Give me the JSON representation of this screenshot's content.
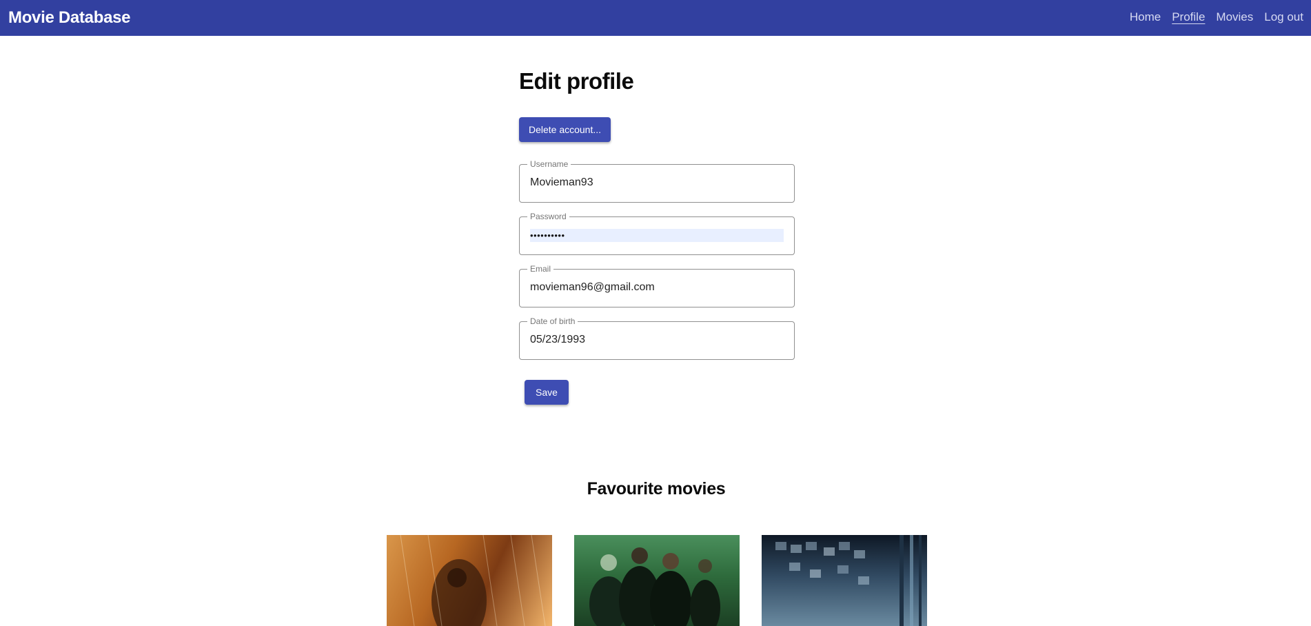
{
  "navbar": {
    "brand": "Movie Database",
    "links": [
      "Home",
      "Profile",
      "Movies",
      "Log out"
    ],
    "active": "Profile",
    "background": "#3240a0"
  },
  "page": {
    "title": "Edit profile",
    "delete_button": "Delete account...",
    "save_button": "Save"
  },
  "form": {
    "username": {
      "label": "Username",
      "value": "Movieman93"
    },
    "password": {
      "label": "Password",
      "value": "••••••••••"
    },
    "email": {
      "label": "Email",
      "value": "movieman96@gmail.com"
    },
    "dob": {
      "label": "Date of birth",
      "value": "05/23/1993"
    }
  },
  "favourites": {
    "title": "Favourite movies",
    "posters": [
      "poster-image",
      "poster-image",
      "poster-image"
    ]
  },
  "colors": {
    "accent": "#3e4db3"
  }
}
